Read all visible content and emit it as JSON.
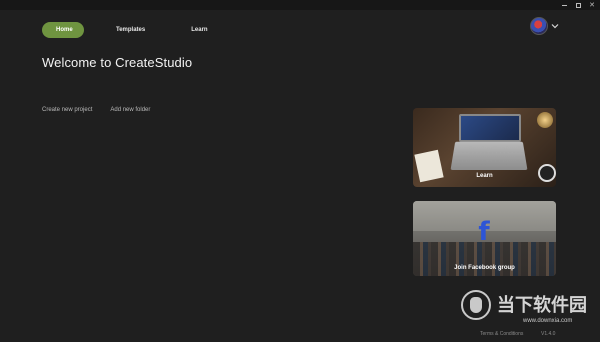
{
  "nav": {
    "tabs": [
      {
        "label": "Home",
        "active": true
      },
      {
        "label": "Templates",
        "active": false
      },
      {
        "label": "Learn",
        "active": false
      }
    ]
  },
  "page": {
    "title": "Welcome to CreateStudio",
    "actions": {
      "create_project": "Create new project",
      "add_folder": "Add new folder"
    }
  },
  "cards": {
    "learn": {
      "label": "Learn"
    },
    "facebook": {
      "label": "Join Facebook group"
    }
  },
  "footer": {
    "terms": "Terms & Conditions",
    "version": "V1.4.0"
  },
  "watermark": {
    "text": "当下软件园",
    "url": "www.downxia.com"
  },
  "colors": {
    "background": "#1f1f1f",
    "accent": "#6f9440",
    "facebook_blue": "#2d55d6"
  },
  "icons": {
    "avatar": "user-avatar",
    "dropdown": "chevron-down-icon",
    "facebook": "facebook-icon"
  }
}
